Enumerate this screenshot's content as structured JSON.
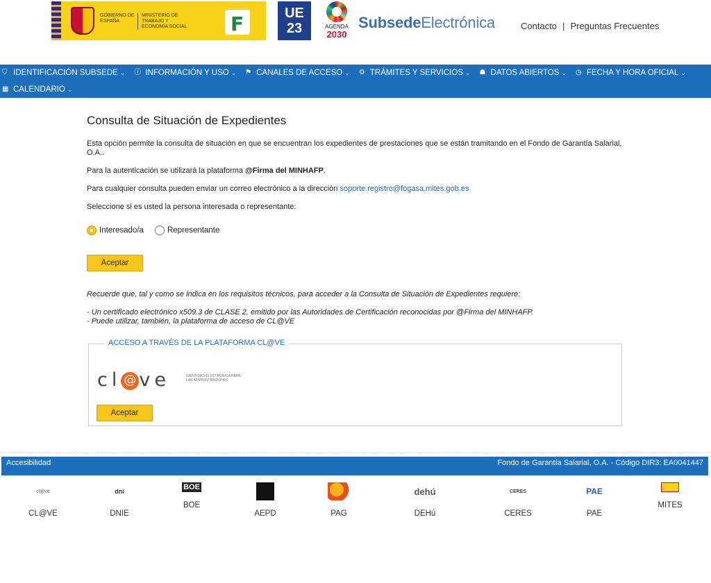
{
  "header": {
    "gov_text1": "GOBIERNO DE ESPAÑA",
    "gov_text2": "MINISTERIO DE TRABAJO Y ECONOMÍA SOCIAL",
    "ue_line1": "UE",
    "ue_line2": "23",
    "agenda_line1": "AGENDA",
    "agenda_line2": "2030",
    "brand_bold": "Subsede",
    "brand_light": "Electrónica",
    "contact": "Contacto",
    "separator": "|",
    "faq": "Preguntas Frecuentes"
  },
  "nav": {
    "row1": [
      {
        "label": "IDENTIFICACIÓN SUBSEDE",
        "icon": "shield-icon",
        "glyph": "⛉"
      },
      {
        "label": "INFORMACIÓN Y USO",
        "icon": "info-icon",
        "glyph": "ⓘ"
      },
      {
        "label": "CANALES DE ACCESO",
        "icon": "signpost-icon",
        "glyph": "⚑"
      },
      {
        "label": "TRÁMITES Y SERVICIOS",
        "icon": "cogs-icon",
        "glyph": "⚙"
      },
      {
        "label": "DATOS ABIERTOS",
        "icon": "users-icon",
        "glyph": "☗"
      },
      {
        "label": "FECHA Y HORA OFICIAL",
        "icon": "clock-icon",
        "glyph": "◷"
      }
    ],
    "row2": [
      {
        "label": "CALENDARIO",
        "icon": "calendar-icon",
        "glyph": "▦"
      }
    ],
    "chevron": "⌄"
  },
  "main": {
    "title": "Consulta de Situación de Expedientes",
    "intro": "Esta opción permite la consulta de situación en que se encuentran los expedientes de prestaciones que se están tramitando en el Fondo de Garantía Salarial, O.A..",
    "auth_prefix": "Para la autenticación se utilizará la plataforma ",
    "auth_bold": "@Firma del MINHAFP",
    "auth_suffix": ".",
    "contact_prefix": "Para cualquier consulta pueden enviar un correo electrónico a la dirección ",
    "contact_email": "soporte.registro@fogasa.mites.gob.es",
    "select_prompt": "Seleccione si es usted la persona interesada o representante:",
    "radio_options": [
      "Interesado/a",
      "Representante"
    ],
    "radio_selected": "Interesado/a",
    "accept_label": "Aceptar",
    "note_intro": "Recuerde que, tal y como se indica en los requisitos técnicos, para acceder a la Consulta de Situación de Expedientes requiere:",
    "note_item1": "- Un certificado electrónico x509.3 de CLASE 2, emitido por las Autoridades de Certificación reconocidas por @Firma del MINHAFP.",
    "note_item2": "- Puede utilizar, también, la plataforma de acceso de CL@VE"
  },
  "clave": {
    "legend": "ACCESO A TRAVÉS DE LA PLATAFORMA CL@VE",
    "logo_left": "cl",
    "logo_at": "@",
    "logo_right": "ve",
    "logo_sub": "IDENTIDAD ELECTRÓNICA PARA LAS ADMINISTRACIONES",
    "accept_label": "Aceptar"
  },
  "footer": {
    "accessibility": "Accesibilidad",
    "org": "Fondo de Garantía Salarial, O.A. - Código DIR3: EA0041447",
    "links": [
      {
        "label": "CL@VE",
        "logo": "cl@ve",
        "icon": "clave-logo"
      },
      {
        "label": "DNIE",
        "logo": "dni",
        "icon": "dnie-logo"
      },
      {
        "label": "BOE",
        "logo": "BOE",
        "icon": "boe-logo"
      },
      {
        "label": "AEPD",
        "logo": "",
        "icon": "aepd-logo"
      },
      {
        "label": "PAG",
        "logo": "",
        "icon": "pag-logo"
      },
      {
        "label": "DEHú",
        "logo": "dehú",
        "icon": "dehu-logo"
      },
      {
        "label": "CERES",
        "logo": "CERES",
        "icon": "ceres-logo"
      },
      {
        "label": "PAE",
        "logo": "PAE",
        "icon": "pae-logo"
      },
      {
        "label": "MITES",
        "logo": "",
        "icon": "mites-logo"
      }
    ]
  }
}
